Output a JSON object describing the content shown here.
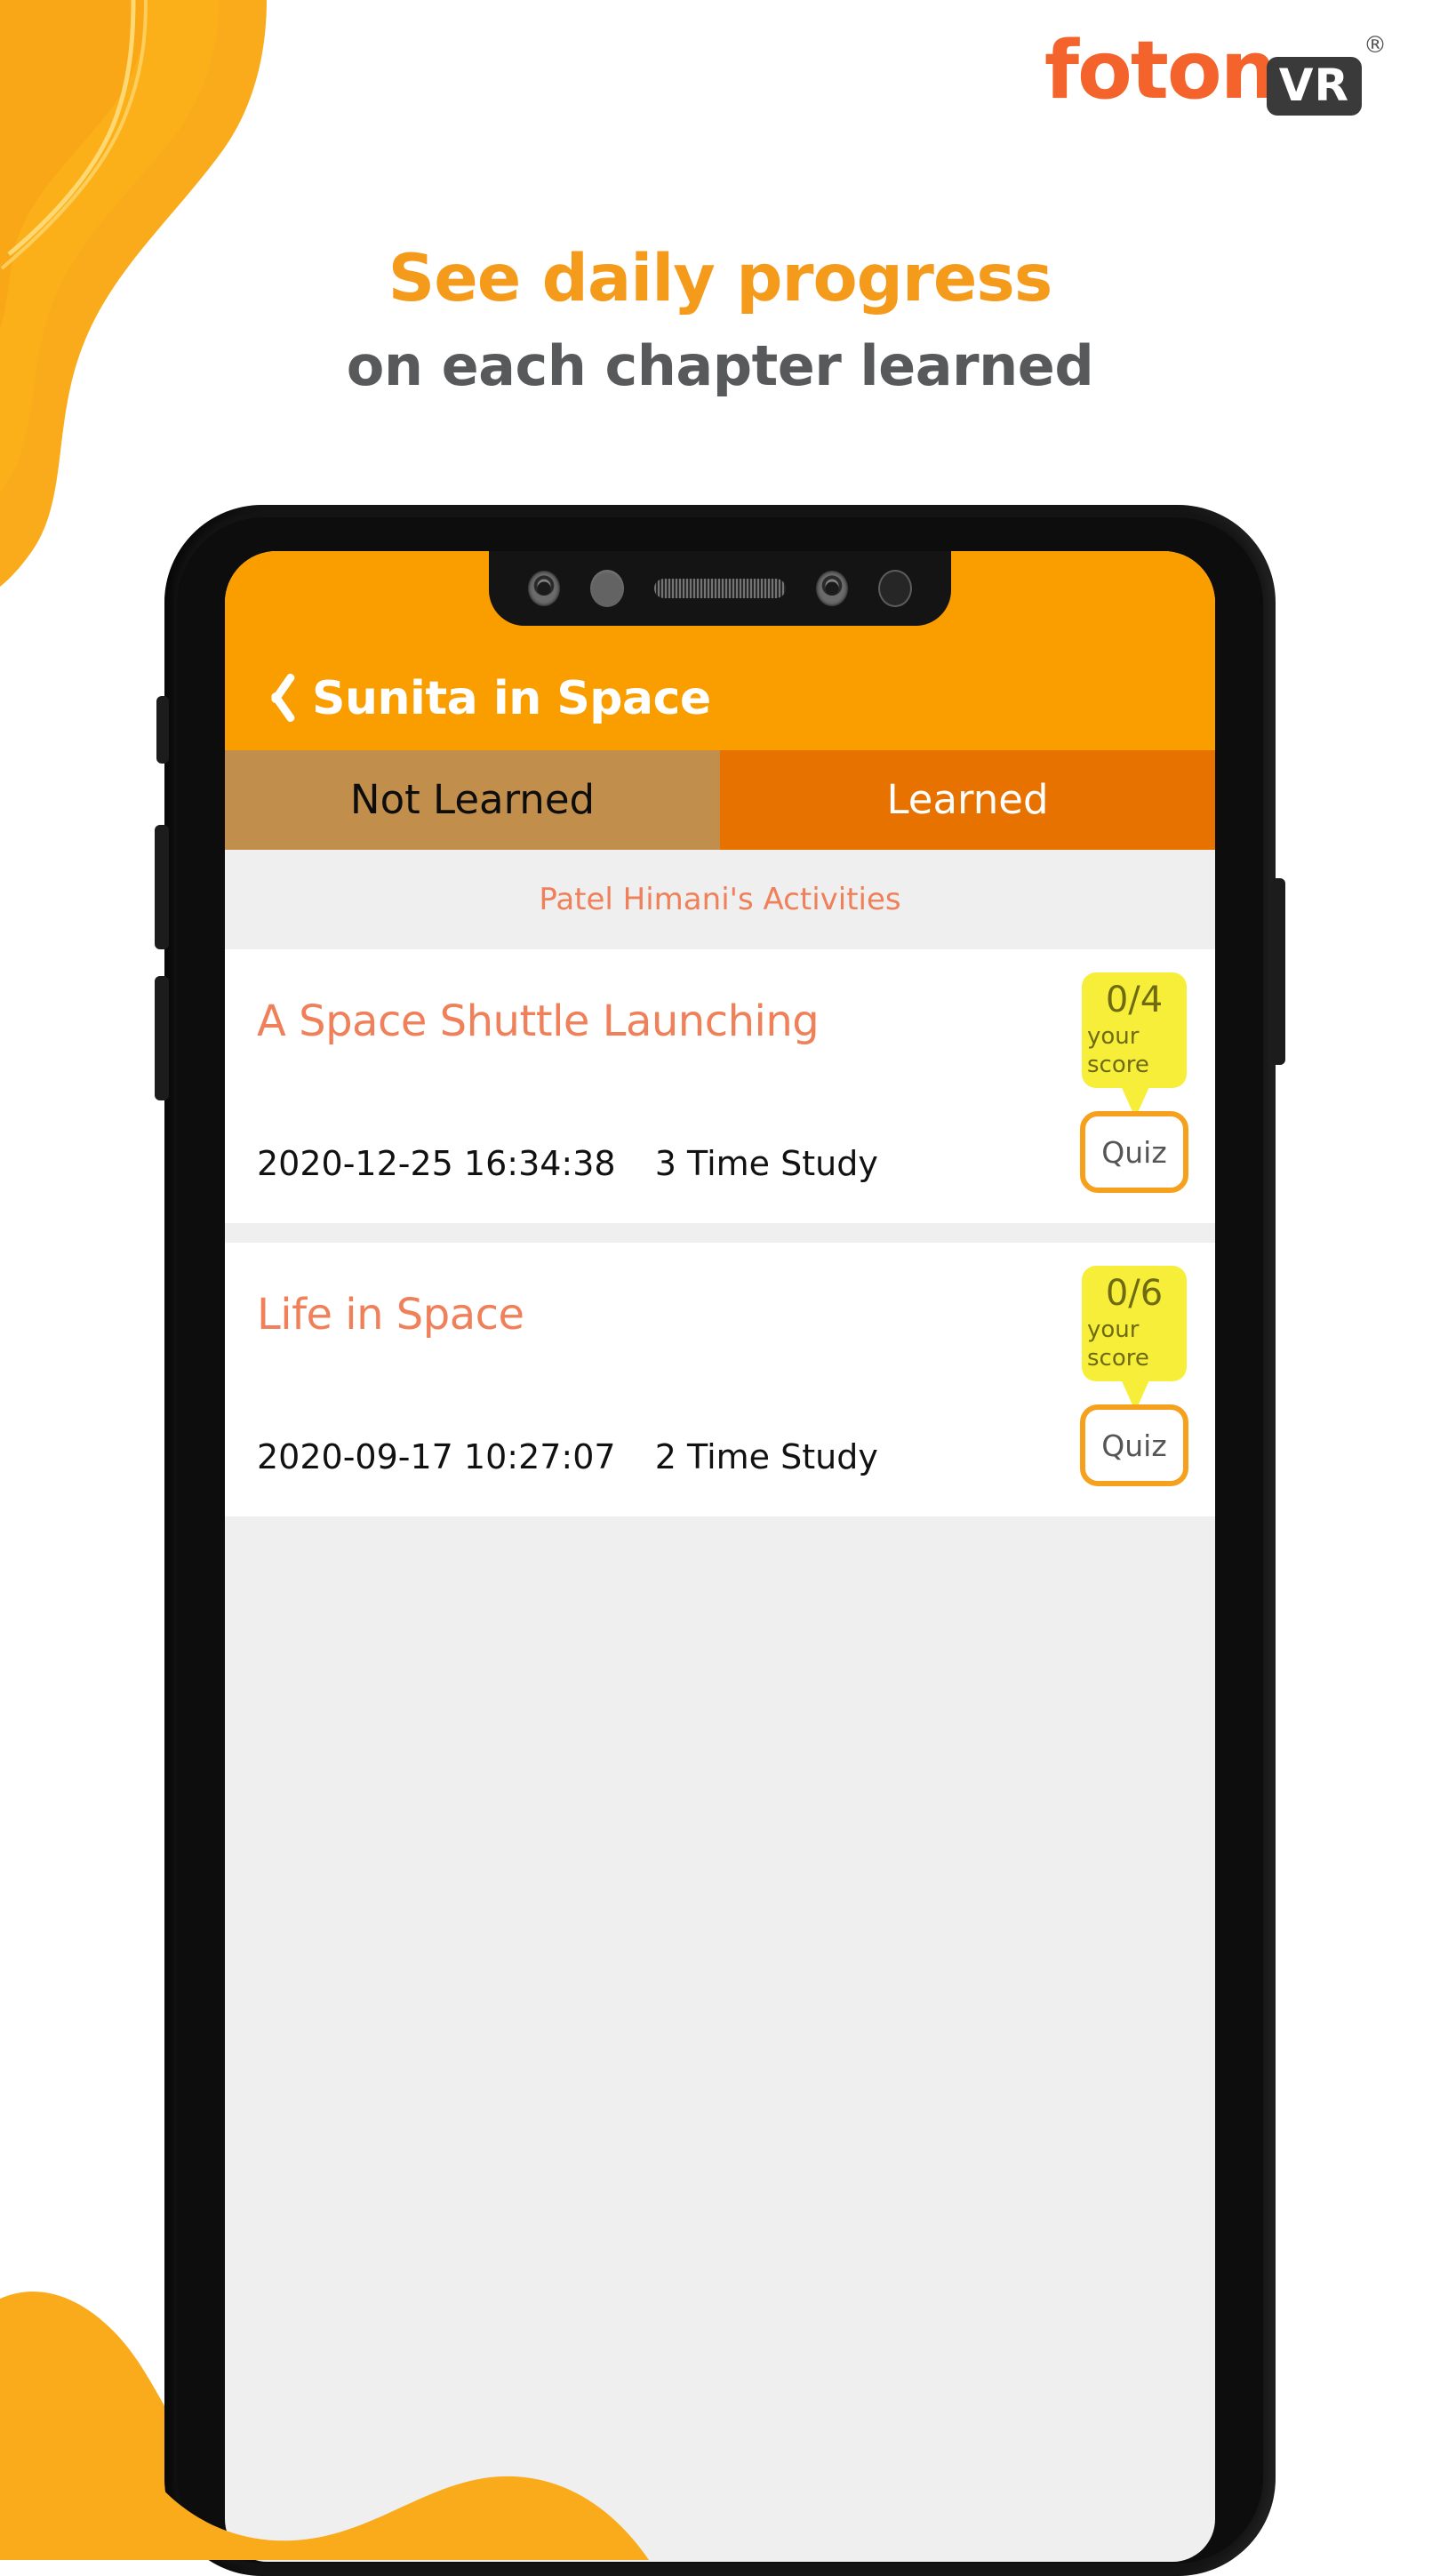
{
  "brand": {
    "word": "foton",
    "badge": "VR",
    "registered": "®"
  },
  "promo": {
    "headline": "See daily progress",
    "subheadline": "on each chapter learned"
  },
  "colors": {
    "brand_orange": "#F4632B",
    "headline_orange": "#F59B1C",
    "appbar_orange": "#FA9E00",
    "tab_active": "#E87200",
    "tab_inactive": "#C28E4B",
    "accent_salmon": "#EF8059",
    "score_yellow": "#F7EE3A",
    "quiz_border": "#F5A11D",
    "screen_bg": "#EFEFEF",
    "subheadline_gray": "#58595B"
  },
  "phone": {
    "notch": {
      "items": [
        "front-camera-icon",
        "proximity-sensor-icon",
        "earpiece-speaker-icon",
        "front-camera-icon",
        "ambient-sensor-icon"
      ]
    },
    "side_buttons": [
      "silent-switch",
      "volume-up-button",
      "volume-down-button",
      "power-button"
    ]
  },
  "app": {
    "appbar": {
      "back_icon": "back-chevron-icon",
      "title": "Sunita in Space"
    },
    "tabs": [
      {
        "label": "Not Learned",
        "active": false
      },
      {
        "label": "Learned",
        "active": true
      }
    ],
    "section_label": "Patel Himani's Activities",
    "activities": [
      {
        "title": "A Space Shuttle Launching",
        "timestamp": "2020-12-25 16:34:38",
        "study_count": "3 Time Study",
        "score": "0/4",
        "score_caption": "your score",
        "quiz_label": "Quiz"
      },
      {
        "title": "Life in Space",
        "timestamp": "2020-09-17 10:27:07",
        "study_count": "2 Time Study",
        "score": "0/6",
        "score_caption": "your score",
        "quiz_label": "Quiz"
      }
    ]
  }
}
